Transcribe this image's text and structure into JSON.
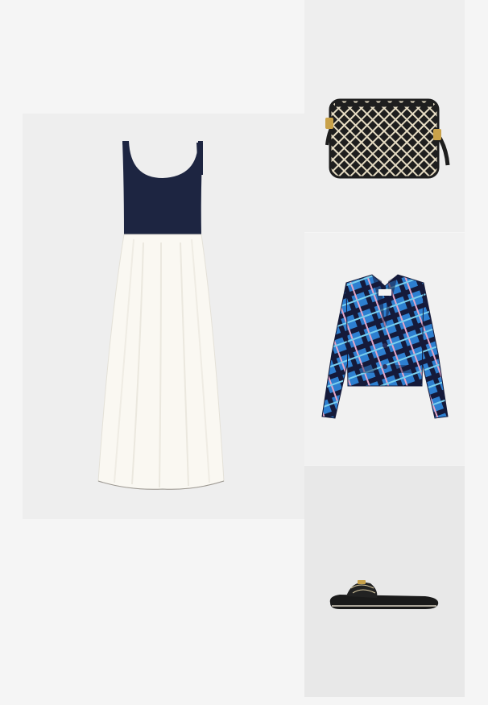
{
  "outfit": {
    "items": [
      {
        "id": "dress",
        "icon": "dress-image"
      },
      {
        "id": "bag",
        "icon": "crossbody-bag-image"
      },
      {
        "id": "jacket",
        "icon": "cropped-jacket-image"
      },
      {
        "id": "sandal",
        "icon": "slide-sandal-image"
      }
    ]
  },
  "colors": {
    "page_bg": "#f5f5f5",
    "panel_bg": "#eeeeee",
    "navy": "#1d2541",
    "cream": "#faf8f2",
    "jacket_blue": "#2d7fd0",
    "jacket_dark": "#151a3a",
    "bag_black": "#1e1e1e",
    "gold": "#c9a24a"
  }
}
